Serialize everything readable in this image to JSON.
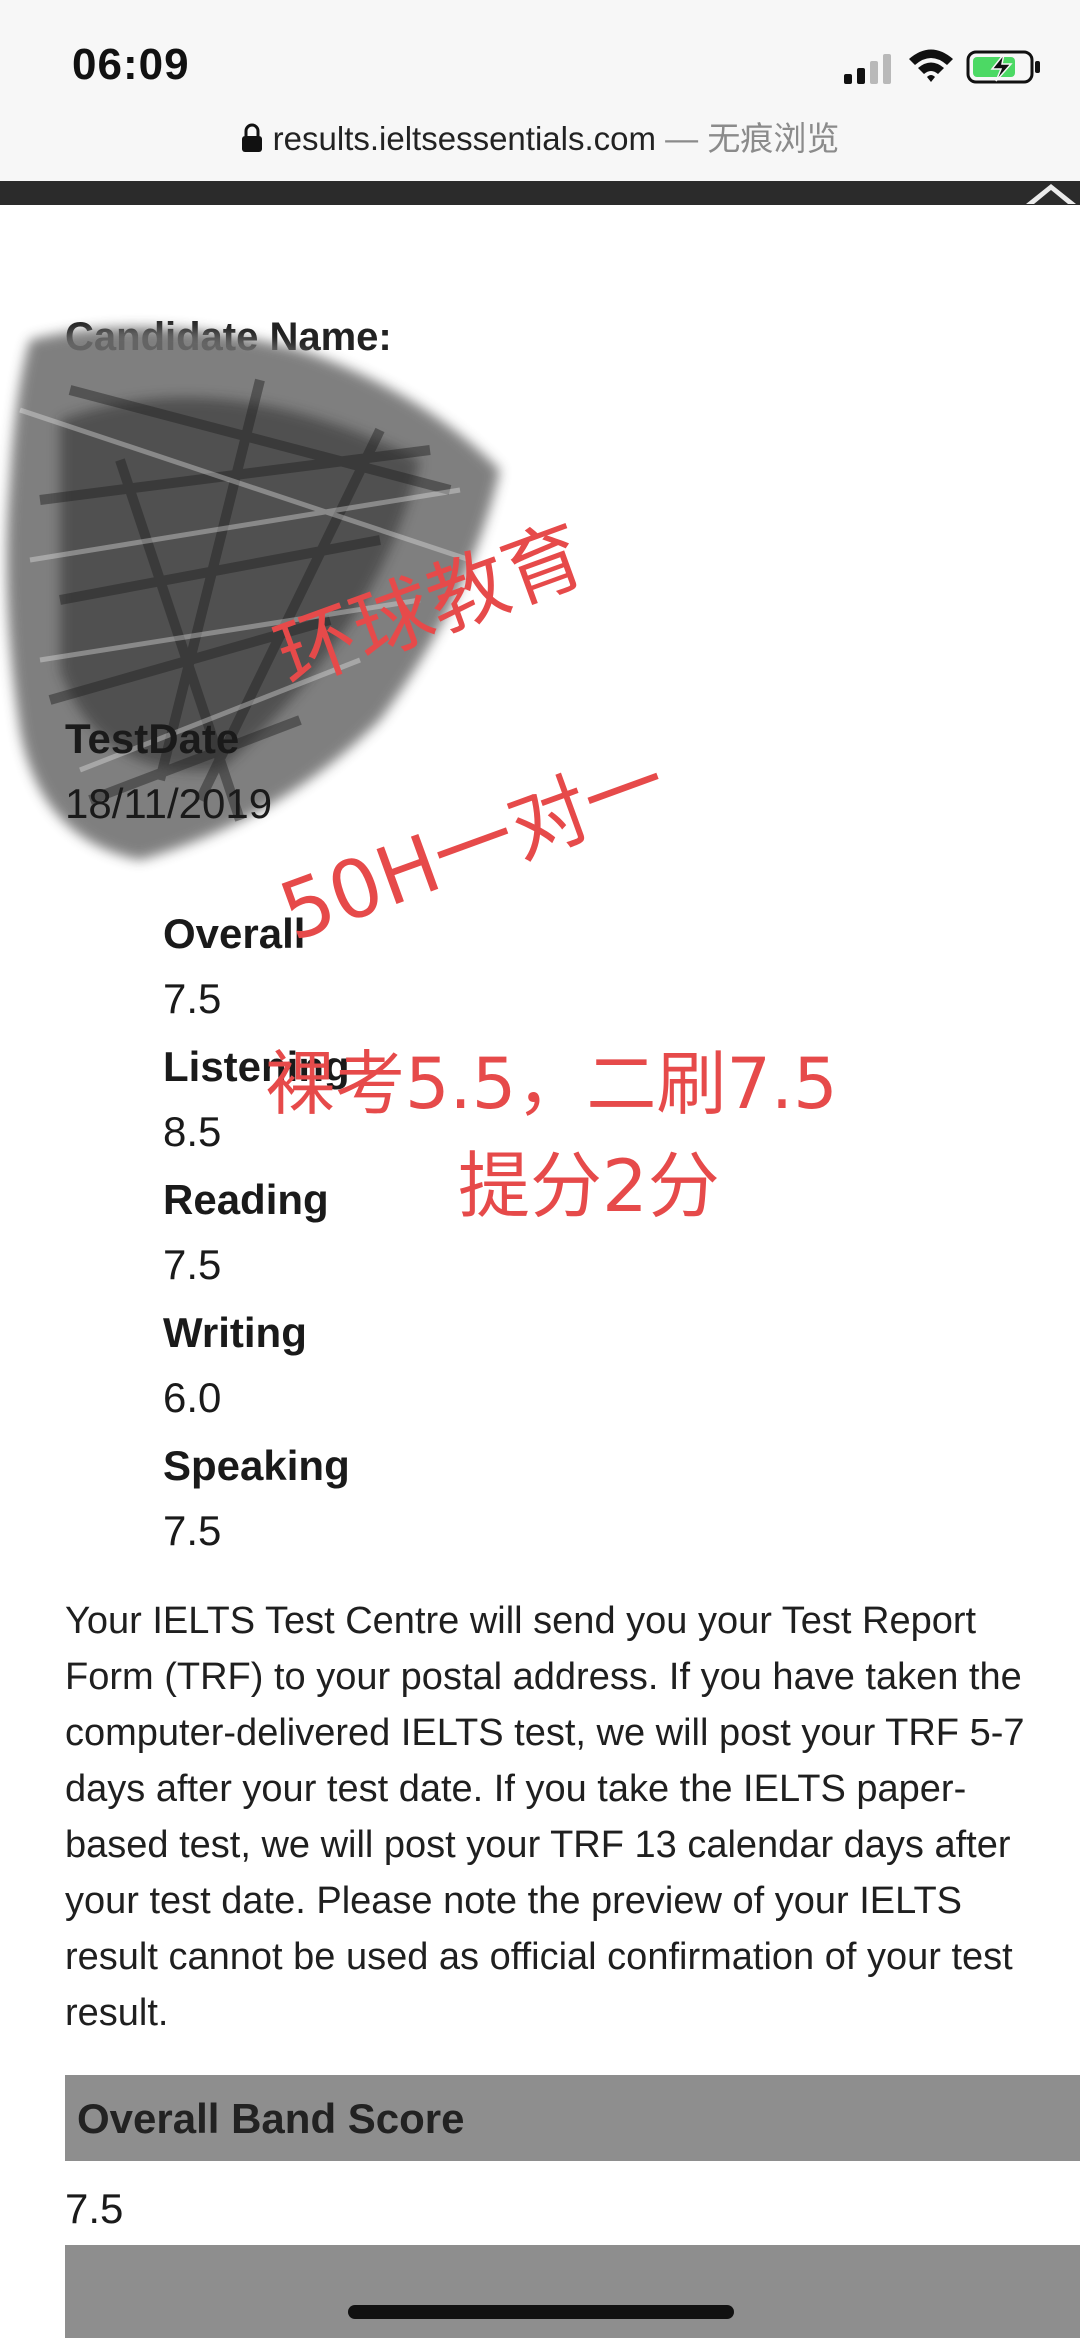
{
  "status_bar": {
    "time": "06:09"
  },
  "browser": {
    "url": "results.ieltsessentials.com",
    "separator": "—",
    "mode": "无痕浏览"
  },
  "candidate": {
    "name_label": "Candidate Name:"
  },
  "test": {
    "date_label": "TestDate",
    "date_value": "18/11/2019"
  },
  "scores": [
    {
      "label": "Overall",
      "value": "7.5"
    },
    {
      "label": "Listening",
      "value": "8.5"
    },
    {
      "label": "Reading",
      "value": "7.5"
    },
    {
      "label": "Writing",
      "value": "6.0"
    },
    {
      "label": "Speaking",
      "value": "7.5"
    }
  ],
  "notice": {
    "lines": [
      "Your IELTS Test Centre will send you your Test Report",
      "Form (TRF) to your postal address. If you have taken the",
      "computer-delivered IELTS test, we will post your TRF 5-7",
      "days after your test date. If you take the IELTS paper-",
      "based test, we will post your TRF 13 calendar days after",
      "your test date. Please note the preview of your IELTS",
      "result cannot be used as official confirmation of your test",
      "result."
    ]
  },
  "band": {
    "title": "Overall Band Score",
    "value": "7.5"
  },
  "overlay": {
    "line1": "环球教育",
    "line2": "50H一对一",
    "line3": "裸考5.5，二刷7.5",
    "line4": "提分2分",
    "color": "#e64a4a"
  }
}
